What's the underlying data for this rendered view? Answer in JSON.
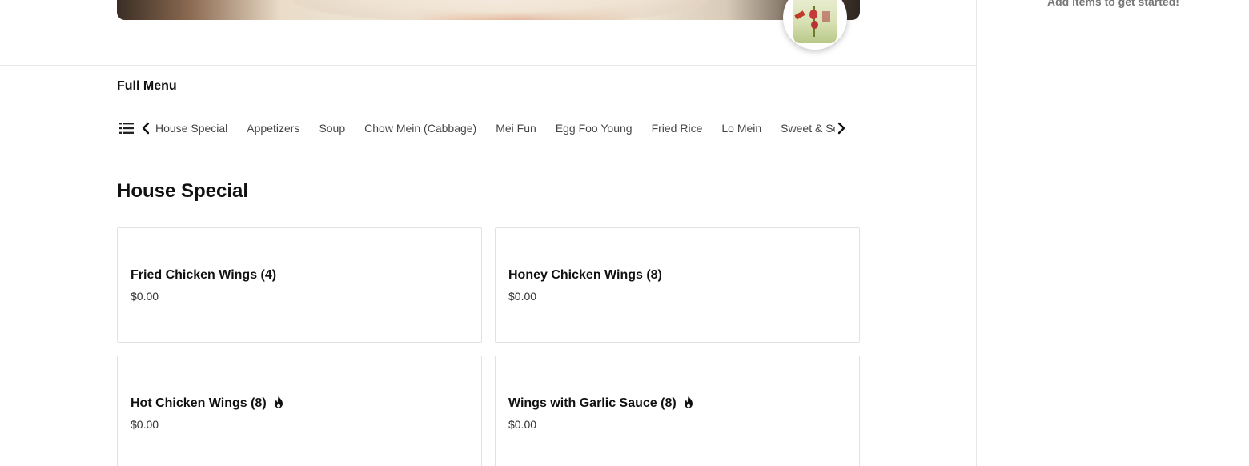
{
  "cart": {
    "empty_message": "Add items to get started!"
  },
  "menu": {
    "title": "Full Menu",
    "categories": [
      "House Special",
      "Appetizers",
      "Soup",
      "Chow Mein (Cabbage)",
      "Mei Fun",
      "Egg Foo Young",
      "Fried Rice",
      "Lo Mein",
      "Sweet & Sour"
    ]
  },
  "section": {
    "title": "House Special",
    "items": [
      {
        "name": "Fried Chicken Wings (4)",
        "price": "$0.00",
        "spicy": false
      },
      {
        "name": "Honey Chicken Wings (8)",
        "price": "$0.00",
        "spicy": false
      },
      {
        "name": "Hot Chicken Wings (8)",
        "price": "$0.00",
        "spicy": true
      },
      {
        "name": "Wings with Garlic Sauce (8)",
        "price": "$0.00",
        "spicy": true
      }
    ]
  },
  "icons": {
    "list": "list-icon",
    "prev": "chevron-left-icon",
    "next": "chevron-right-icon",
    "spicy": "flame-icon"
  }
}
